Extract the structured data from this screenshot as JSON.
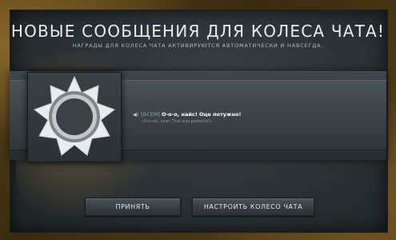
{
  "dialog": {
    "title": "НОВЫЕ СООБЩЕНИЯ ДЛЯ КОЛЕСА ЧАТА!",
    "subtitle": "НАГРАДЫ ДЛЯ КОЛЕСА ЧАТА АКТИВИРУЮТСЯ АВТОМАТИЧЕСКИ И НАВСЕГДА."
  },
  "reward": {
    "icon": "compass-emblem-icon",
    "speaker_icon": "speaker-icon",
    "channel_tag": "[ВСЕМ]",
    "message": "О-о-о, найс! Оце потужно!",
    "translation": "«O-o-oh, nice! That was powerful!»"
  },
  "buttons": {
    "accept": "ПРИНЯТЬ",
    "configure": "НАСТРОИТЬ КОЛЕСО ЧАТА"
  },
  "colors": {
    "frame_gold": "#5c4418",
    "panel": "#2a3034",
    "text": "#e8ecee"
  }
}
